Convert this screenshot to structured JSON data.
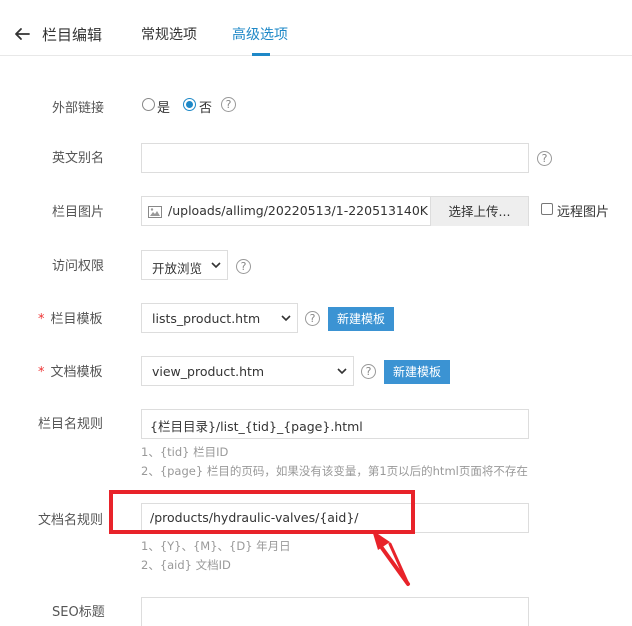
{
  "header": {
    "title": "栏目编辑",
    "tabs": [
      {
        "label": "常规选项",
        "active": false
      },
      {
        "label": "高级选项",
        "active": true
      }
    ],
    "accent_color": "#1e88c7"
  },
  "form": {
    "external_link": {
      "label": "外部链接",
      "options": [
        "是",
        "否"
      ],
      "selected": "否",
      "help": "?"
    },
    "english_alias": {
      "label": "英文别名",
      "value": "",
      "help": "?"
    },
    "column_image": {
      "label": "栏目图片",
      "value": "/uploads/allimg/20220513/1-220513140K",
      "upload_label": "选择上传...",
      "remote_label": "远程图片",
      "remote_checked": false
    },
    "access": {
      "label": "访问权限",
      "selected": "开放浏览",
      "help": "?"
    },
    "column_template": {
      "required": "*",
      "label": "栏目模板",
      "selected": "lists_product.htm",
      "help": "?",
      "new_button": "新建模板"
    },
    "doc_template": {
      "required": "*",
      "label": "文档模板",
      "selected": "view_product.htm",
      "help": "?",
      "new_button": "新建模板"
    },
    "column_rule": {
      "label": "栏目名规则",
      "value": "{栏目目录}/list_{tid}_{page}.html",
      "hints": [
        "1、{tid} 栏目ID",
        "2、{page} 栏目的页码，如果没有该变量，第1页以后的html页面将不存在"
      ]
    },
    "doc_rule": {
      "label": "文档名规则",
      "value": "/products/hydraulic-valves/{aid}/",
      "hints": [
        "1、{Y}、{M}、{D} 年月日",
        "2、{aid} 文档ID"
      ]
    },
    "seo_title": {
      "label": "SEO标题",
      "value": ""
    }
  },
  "annotation_color": "#e8232a"
}
